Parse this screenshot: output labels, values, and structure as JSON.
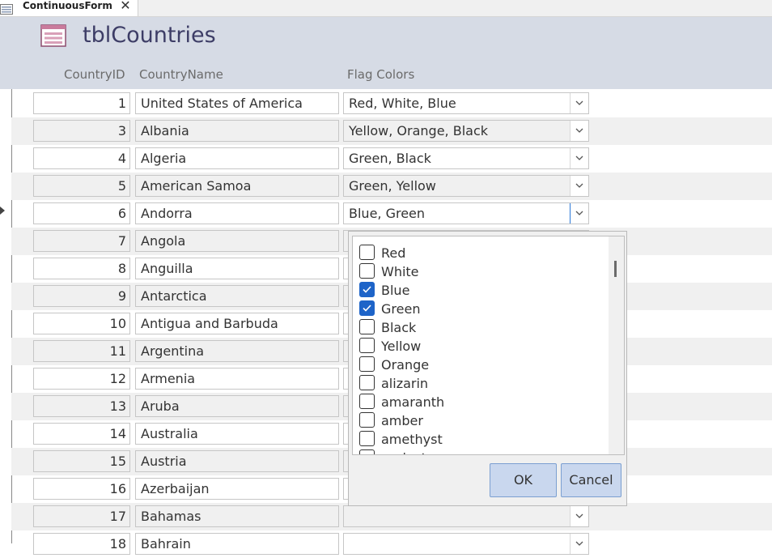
{
  "tab": {
    "label": "ContinuousForm",
    "close_glyph": "✕",
    "icon": "form-icon"
  },
  "header": {
    "title": "tblCountries",
    "icon": "form-icon",
    "columns": {
      "id": "CountryID",
      "name": "CountryName",
      "flag": "Flag Colors"
    }
  },
  "rows": [
    {
      "id": "1",
      "name": "United States of America",
      "flag": "Red, White, Blue"
    },
    {
      "id": "3",
      "name": "Albania",
      "flag": "Yellow, Orange, Black"
    },
    {
      "id": "4",
      "name": "Algeria",
      "flag": "Green, Black"
    },
    {
      "id": "5",
      "name": "American Samoa",
      "flag": "Green, Yellow"
    },
    {
      "id": "6",
      "name": "Andorra",
      "flag": "Blue, Green"
    },
    {
      "id": "7",
      "name": "Angola",
      "flag": ""
    },
    {
      "id": "8",
      "name": "Anguilla",
      "flag": ""
    },
    {
      "id": "9",
      "name": "Antarctica",
      "flag": ""
    },
    {
      "id": "10",
      "name": "Antigua and Barbuda",
      "flag": ""
    },
    {
      "id": "11",
      "name": "Argentina",
      "flag": ""
    },
    {
      "id": "12",
      "name": "Armenia",
      "flag": ""
    },
    {
      "id": "13",
      "name": "Aruba",
      "flag": ""
    },
    {
      "id": "14",
      "name": "Australia",
      "flag": ""
    },
    {
      "id": "15",
      "name": "Austria",
      "flag": ""
    },
    {
      "id": "16",
      "name": "Azerbaijan",
      "flag": ""
    },
    {
      "id": "17",
      "name": "Bahamas",
      "flag": ""
    },
    {
      "id": "18",
      "name": "Bahrain",
      "flag": ""
    }
  ],
  "current_row_index": 4,
  "dropdown": {
    "items": [
      {
        "label": "Red",
        "checked": false
      },
      {
        "label": "White",
        "checked": false
      },
      {
        "label": "Blue",
        "checked": true
      },
      {
        "label": "Green",
        "checked": true
      },
      {
        "label": "Black",
        "checked": false
      },
      {
        "label": "Yellow",
        "checked": false
      },
      {
        "label": "Orange",
        "checked": false
      },
      {
        "label": "alizarin",
        "checked": false
      },
      {
        "label": "amaranth",
        "checked": false
      },
      {
        "label": "amber",
        "checked": false
      },
      {
        "label": "amethyst",
        "checked": false
      },
      {
        "label": "apricot",
        "checked": false
      }
    ],
    "ok_label": "OK",
    "cancel_label": "Cancel"
  },
  "colors": {
    "header_bg": "#d6dbe5",
    "title": "#3d3d66",
    "check_on": "#1e64c8",
    "button_bg": "#c9d7ee",
    "focus_border": "#2b79d8"
  }
}
